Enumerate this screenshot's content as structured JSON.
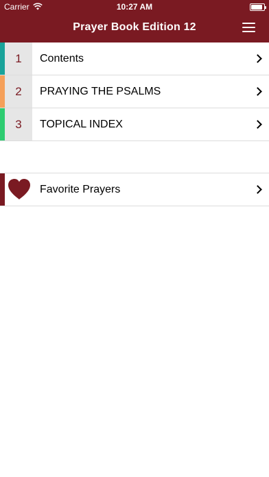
{
  "status_bar": {
    "carrier": "Carrier",
    "time": "10:27 AM"
  },
  "header": {
    "title": "Prayer Book Edition 12"
  },
  "colors": {
    "header_bg": "#7a1a22",
    "stripe_teal": "#1aa39a",
    "stripe_orange": "#f5a05a",
    "stripe_green": "#2ecc71",
    "favorites_accent": "#7a1a22"
  },
  "list": {
    "items": [
      {
        "number": "1",
        "label": "Contents",
        "stripe_color": "#1aa39a"
      },
      {
        "number": "2",
        "label": "PRAYING THE PSALMS",
        "stripe_color": "#f5a05a"
      },
      {
        "number": "3",
        "label": "TOPICAL INDEX",
        "stripe_color": "#2ecc71"
      }
    ]
  },
  "favorites": {
    "label": "Favorite Prayers",
    "icon": "heart-icon"
  }
}
